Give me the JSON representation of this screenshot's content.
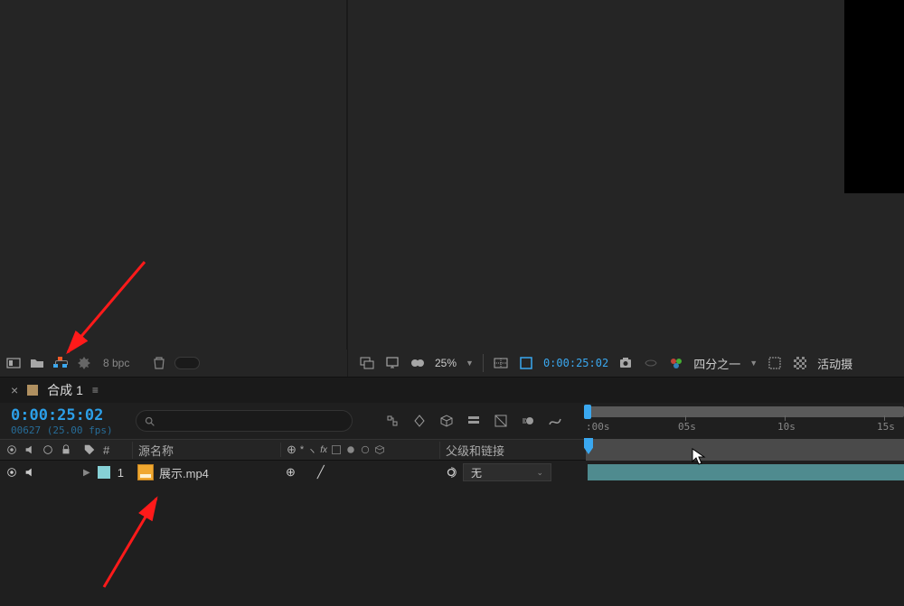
{
  "project_tools": {
    "bpc": "8 bpc"
  },
  "comp_tools": {
    "zoom": "25%",
    "time": "0:00:25:02",
    "resolution": "四分之一",
    "camera": "活动摄"
  },
  "timeline": {
    "tab_label": "合成 1",
    "timecode": "0:00:25:02",
    "timecode_sub": "00627 (25.00 fps)",
    "columns": {
      "sourcename": "源名称",
      "parent": "父级和链接"
    },
    "layer": {
      "index": "1",
      "name": "展示.mp4",
      "parent_value": "无"
    },
    "ruler": {
      "t0": ":00s",
      "t5": "05s",
      "t10": "10s",
      "t15": "15s"
    }
  }
}
